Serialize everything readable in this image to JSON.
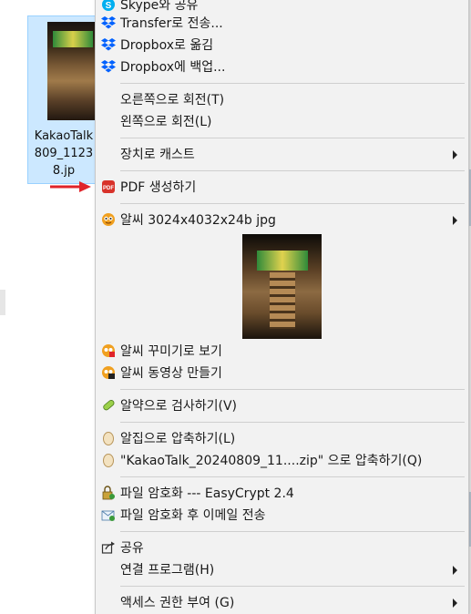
{
  "file": {
    "name": "KakaoTalk\n809_1123\n8.jp"
  },
  "menu": {
    "items": [
      {
        "label": "Skype와 공유",
        "icon": "skype-icon"
      },
      {
        "label": "Transfer로 전송...",
        "icon": "dropbox-icon"
      },
      {
        "label": "Dropbox로 옮김",
        "icon": "dropbox-icon"
      },
      {
        "label": "Dropbox에 백업...",
        "icon": "dropbox-icon"
      },
      {
        "label": "오른쪽으로 회전(T)"
      },
      {
        "label": "왼쪽으로 회전(L)"
      },
      {
        "label": "장치로 캐스트",
        "submenu": true
      },
      {
        "label": "PDF 생성하기",
        "icon": "pdf-icon"
      },
      {
        "label": "알씨 3024x4032x24b jpg",
        "icon": "alsee-icon",
        "submenu": true
      },
      {
        "label": "알씨 꾸미기로 보기",
        "icon": "alsee-decorate-icon"
      },
      {
        "label": "알씨 동영상 만들기",
        "icon": "alsee-video-icon"
      },
      {
        "label": "알약으로 검사하기(V)",
        "icon": "alyac-icon"
      },
      {
        "label": "알집으로 압축하기(L)",
        "icon": "alzip-icon"
      },
      {
        "label": "\"KakaoTalk_20240809_11....zip\" 으로 압축하기(Q)",
        "icon": "alzip-icon"
      },
      {
        "label": "파일 암호화 --- EasyCrypt 2.4",
        "icon": "easycrypt-icon"
      },
      {
        "label": "파일 암호화 후 이메일 전송",
        "icon": "easycrypt-mail-icon"
      },
      {
        "label": "공유",
        "icon": "share-icon"
      },
      {
        "label": "연결 프로그램(H)",
        "submenu": true
      },
      {
        "label": "액세스 권한 부여 (G)",
        "submenu": true
      }
    ]
  },
  "colors": {
    "menu_bg": "#f2f2f2",
    "selection_bg": "#cce8ff",
    "arrow_red": "#e0242a",
    "dropbox_blue": "#0061fe",
    "skype_blue": "#00aff0",
    "pdf_red": "#d8322a"
  }
}
